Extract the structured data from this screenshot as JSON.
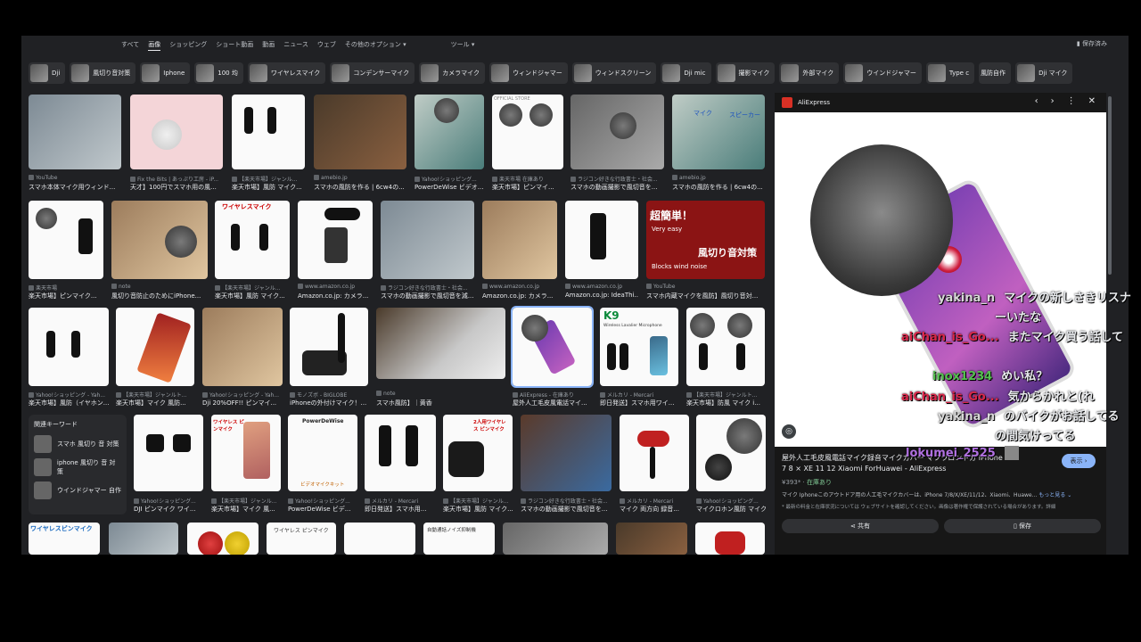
{
  "tabs": [
    "すべて",
    "画像",
    "ショッピング",
    "ショート動画",
    "動画",
    "ニュース",
    "ウェブ",
    "その他のオプション ▾",
    "ツール ▾"
  ],
  "active_tab": 1,
  "saved_label": "保存済み",
  "chips": [
    "Dji",
    "風切り音対策",
    "Iphone",
    "100 均",
    "ワイヤレスマイク",
    "コンデンサーマイク",
    "カメラマイク",
    "ウィンドジャマー",
    "ウィンドスクリーン",
    "Dji mic",
    "撮影マイク",
    "外部マイク",
    "ウインドジャマー",
    "Type c",
    "風防自作",
    "Dji マイク"
  ],
  "row1": [
    {
      "src": "YouTube",
      "title": "スマホ本体マイク用ウィンド..."
    },
    {
      "src": "Fix the Bits | あっぷり工房 - iP...",
      "title": "天才】100円でスマホ用の風..."
    },
    {
      "src": "【楽天市場】ジャンル...",
      "title": "楽天市場】風防 マイク..."
    },
    {
      "src": "amebio.jp",
      "title": "スマホの風防を作る | 6cw4の..."
    },
    {
      "src": "Yahoo!ショッピング...",
      "title": "PowerDeWise ビデオ..."
    },
    {
      "src": "楽天市場 在庫あり",
      "title": "楽天市場】ピンマイ..."
    },
    {
      "src": "ラジコン好きな行政書士・社会...",
      "title": "スマホの動画撮影で風切音を..."
    },
    {
      "src": "amebio.jp",
      "title": "スマホの風防を作る | 6cw4の..."
    }
  ],
  "row2": [
    {
      "src": "楽天市場",
      "title": "楽天市場】ピンマイク..."
    },
    {
      "src": "note",
      "title": "風切り音防止のためにiPhone..."
    },
    {
      "src": "【楽天市場】ジャンル...",
      "title": "楽天市場】風防 マイク..."
    },
    {
      "src": "www.amazon.co.jp",
      "title": "Amazon.co.jp: カメラ..."
    },
    {
      "src": "ラジコン好きな行政書士・社会...",
      "title": "スマホの動画撮影で風切音を減..."
    },
    {
      "src": "www.amazon.co.jp",
      "title": "Amazon.co.jp: カメラ..."
    },
    {
      "src": "www.amazon.co.jp",
      "title": "Amazon.co.jp: IdeaThi..."
    },
    {
      "src": "YouTube",
      "title": "スマホ内蔵マイクを風防】風切り音対..."
    }
  ],
  "row3": [
    {
      "src": "Yahoo!ショッピング - Yah...",
      "title": "楽天市場】風防（イヤホン..."
    },
    {
      "src": "【楽天市場】ジャンルト...",
      "title": "楽天市場】マイク 風防..."
    },
    {
      "src": "Yahoo!ショッピング - Yah...",
      "title": "Dji 20%OFF!! ピンマイ..."
    },
    {
      "src": "モノズボ - BIGLOBE",
      "title": "iPhoneの外付けマイク！..."
    },
    {
      "src": "note",
      "title": "スマホ風防】｜黄香"
    },
    {
      "src": "AliExpress - 在庫あり",
      "title": "屋外人工毛皮風電話マイ..."
    },
    {
      "src": "メルカリ - Mercari",
      "title": "即日発送】スマホ用ワイ..."
    },
    {
      "src": "【楽天市場】ジャンルト...",
      "title": "楽天市場】防風 マイク i..."
    }
  ],
  "row4": [
    {
      "src": "Yahoo!ショッピング...",
      "title": "DJI ピンマイク ワイ..."
    },
    {
      "src": "【楽天市場】ジャンル...",
      "title": "楽天市場】マイク 風..."
    },
    {
      "src": "Yahoo!ショッピング...",
      "title": "PowerDeWise ビデ..."
    },
    {
      "src": "メルカリ - Mercari",
      "title": "即日発送】スマホ用..."
    },
    {
      "src": "【楽天市場】ジャンル...",
      "title": "楽天市場】風防 マイク..."
    },
    {
      "src": "ラジコン好きな行政書士・社会...",
      "title": "スマホの動画撮影で風切音を..."
    },
    {
      "src": "メルカリ - Mercari",
      "title": "マイク 両方向 録音..."
    },
    {
      "src": "Yahoo!ショッピング...",
      "title": "マイクロホン風防 マイク..."
    }
  ],
  "image_labels": {
    "r2_3": "ワイヤレスマイク",
    "r2_8a": "超簡単！",
    "r2_8b": "Very easy",
    "r2_8c": "風切り音対策",
    "r2_8d": "Blocks wind noise",
    "r3_7": "K9",
    "r3_7b": "Wireless Lavalier Microphone",
    "r4_3": "PowerDeWise",
    "r4_3b": "ビデオマイクキット",
    "r4_2": "ワイヤレス ピンマイク",
    "r4_5": "2人用ワイヤレス ピンマイク",
    "r5_1": "ワイヤレスピンマイク",
    "r5_3": "ワイヤレス ピンマイク",
    "r5_5": "自動通話ノイズ抑制機",
    "r1_6": "OFFICIAL STORE",
    "r1_8a": "マイク",
    "r1_8b": "スピーカー"
  },
  "related": {
    "header": "関連キーワード",
    "items": [
      "スマホ 風切り 音 対策",
      "iphone 風切り 音 対策",
      "ウインドジャマー 自作"
    ]
  },
  "panel": {
    "source": "AliExpress",
    "title": "屋外人工毛皮風電話マイク録音マイクカバー マフラロントガ iPhone 7 8 × XE 11 12 Xiaomi ForHuawei - AliExpress",
    "visit": "表示 ›",
    "price": "¥393*",
    "stock": "在庫あり",
    "desc": "マイク Iphoneこのアウトドア用の人工毛マイクカバーは、iPhone 7/8/X/XE/11/12、Xiaomi、Huawe...",
    "more": "もっと見る ⌄",
    "note": "* 最新の料金と在庫状況については ウェブサイトを確認してください。画像は著作権で保護されている場合があります。詳細",
    "share": "共有",
    "save": "保存"
  },
  "chat": [
    {
      "user": "yakina_n",
      "text": "マイクの新しさきリスナ",
      "ucolor": "#d8d8d8",
      "tcolor": "#ffffff"
    },
    {
      "user": "",
      "text": "ーいたな",
      "ucolor": "#ffffff",
      "tcolor": "#ffffff"
    },
    {
      "user": "aiChan_is_Go...",
      "text": "またマイク買う話して",
      "ucolor": "#d8284a",
      "tcolor": "#ffffff"
    },
    {
      "user": "inox1234",
      "text": "めい私？",
      "ucolor": "#55c050",
      "tcolor": "#ffffff"
    },
    {
      "user": "aiChan_is_Go...",
      "text": "気からかれと(れ",
      "ucolor": "#d8284a",
      "tcolor": "#ffffff"
    },
    {
      "user": "yakina_n",
      "text": "のバイクがお話してる",
      "ucolor": "#d8d8d8",
      "tcolor": "#ffffff"
    },
    {
      "user": "",
      "text": "の間気けってる",
      "ucolor": "#ffffff",
      "tcolor": "#ffffff"
    },
    {
      "user": "lokumei_2525",
      "text": "",
      "ucolor": "#b070e0",
      "tcolor": "#ffffff"
    }
  ]
}
